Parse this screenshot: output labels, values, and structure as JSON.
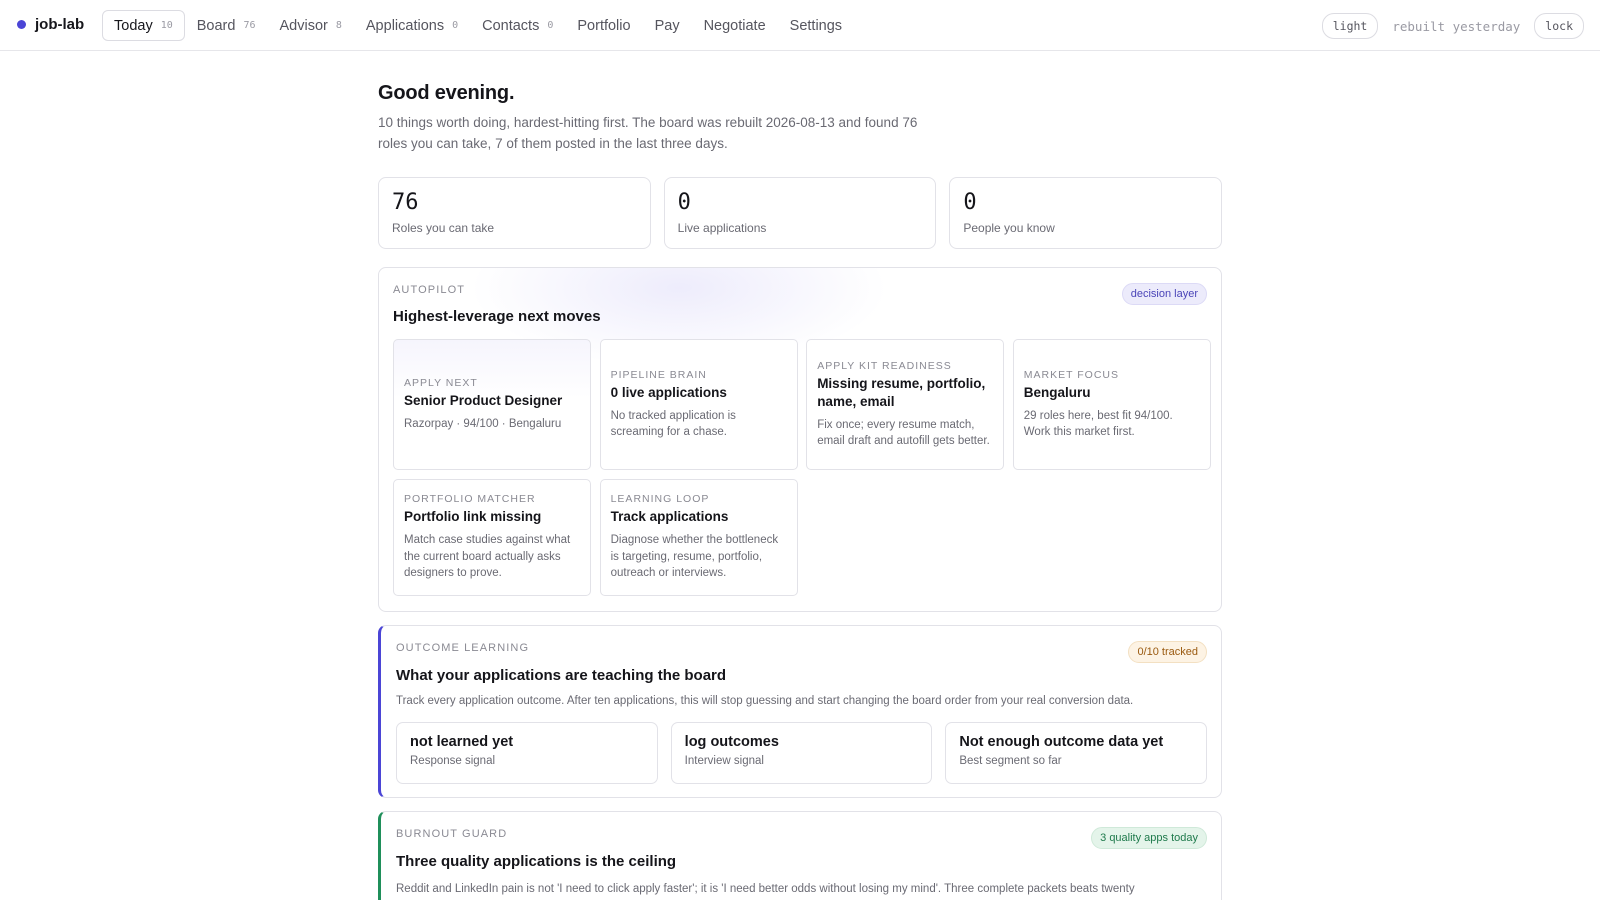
{
  "brand": {
    "name": "job-lab",
    "accent": "#4b45d6"
  },
  "nav": {
    "tabs": [
      {
        "label": "Today",
        "count": "10",
        "active": true
      },
      {
        "label": "Board",
        "count": "76"
      },
      {
        "label": "Advisor",
        "count": "8"
      },
      {
        "label": "Applications",
        "count": "0"
      },
      {
        "label": "Contacts",
        "count": "0"
      },
      {
        "label": "Portfolio"
      },
      {
        "label": "Pay"
      },
      {
        "label": "Negotiate"
      },
      {
        "label": "Settings"
      }
    ],
    "theme_label": "light",
    "rebuilt_label": "rebuilt yesterday",
    "lock_label": "lock"
  },
  "header": {
    "greeting": "Good evening.",
    "intro": "10 things worth doing, hardest-hitting first. The board was rebuilt 2026-08-13 and found 76 roles you can take, 7 of them posted in the last three days."
  },
  "stats": [
    {
      "value": "76",
      "label": "Roles you can take"
    },
    {
      "value": "0",
      "label": "Live applications"
    },
    {
      "value": "0",
      "label": "People you know"
    }
  ],
  "autopilot": {
    "kicker": "AUTOPILOT",
    "title": "Highest-leverage next moves",
    "badge": "decision layer",
    "tiles": [
      {
        "kicker": "APPLY NEXT",
        "title": "Senior Product Designer",
        "body": "Razorpay · 94/100 · Bengaluru"
      },
      {
        "kicker": "PIPELINE BRAIN",
        "title": "0 live applications",
        "body": "No tracked application is screaming for a chase."
      },
      {
        "kicker": "APPLY KIT READINESS",
        "title": "Missing resume, portfolio, name, email",
        "body": "Fix once; every resume match, email draft and autofill gets better."
      },
      {
        "kicker": "MARKET FOCUS",
        "title": "Bengaluru",
        "body": "29 roles here, best fit 94/100. Work this market first."
      },
      {
        "kicker": "PORTFOLIO MATCHER",
        "title": "Portfolio link missing",
        "body": "Match case studies against what the current board actually asks designers to prove."
      },
      {
        "kicker": "LEARNING LOOP",
        "title": "Track applications",
        "body": "Diagnose whether the bottleneck is targeting, resume, portfolio, outreach or interviews."
      }
    ]
  },
  "outcome": {
    "kicker": "OUTCOME LEARNING",
    "title": "What your applications are teaching the board",
    "badge": "0/10 tracked",
    "desc": "Track every application outcome. After ten applications, this will stop guessing and start changing the board order from your real conversion data.",
    "signals": [
      {
        "value": "not learned yet",
        "label": "Response signal"
      },
      {
        "value": "log outcomes",
        "label": "Interview signal"
      },
      {
        "value": "Not enough outcome data yet",
        "label": "Best segment so far"
      }
    ],
    "accent": "#4b45d6"
  },
  "burnout": {
    "kicker": "BURNOUT GUARD",
    "title": "Three quality applications is the ceiling",
    "badge": "3 quality apps today",
    "desc": "Reddit and LinkedIn pain is not 'I need to click apply faster'; it is 'I need better odds without losing my mind'. Three complete packets beats twenty",
    "accent": "#1f8f5a"
  }
}
